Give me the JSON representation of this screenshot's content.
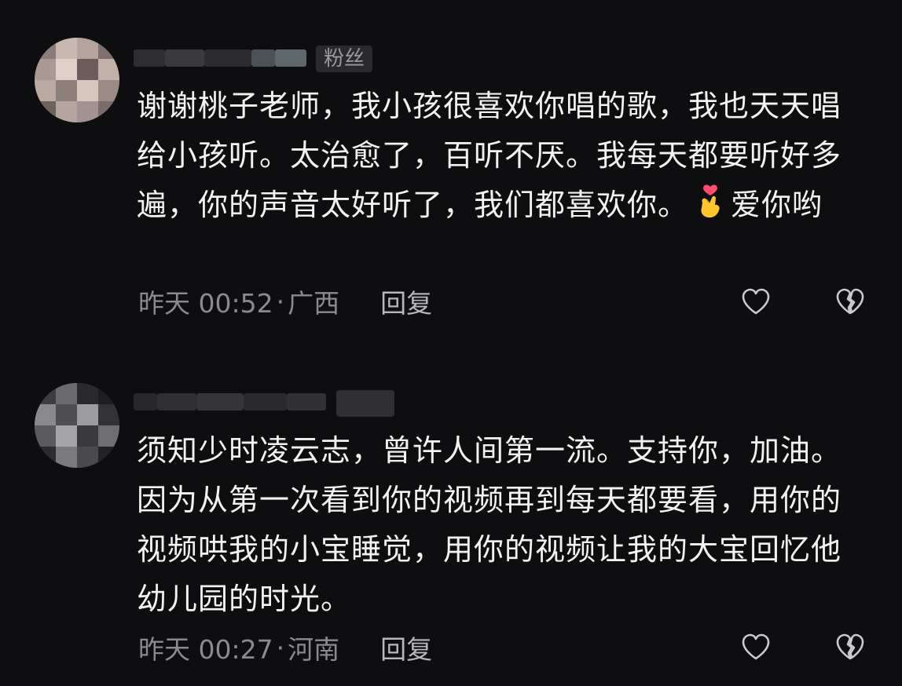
{
  "comments": [
    {
      "badge": "粉丝",
      "text_before_emoji": "谢谢桃子老师，我小孩很喜欢你唱的歌，我也天天唱给小孩听。太治愈了，百听不厌。我每天都要听好多遍，你的声音太好听了，我们都喜欢你。",
      "emoji_name": "finger-heart-emoji",
      "text_after_emoji": "爱你哟",
      "time": "昨天 00:52",
      "separator": "·",
      "location": "广西",
      "reply_label": "回复",
      "like_icon": "heart-outline-icon",
      "dislike_icon": "broken-heart-icon"
    },
    {
      "badge": "",
      "text_before_emoji": "须知少时凌云志，曾许人间第一流。支持你，加油。因为从第一次看到你的视频再到每天都要看，用你的视频哄我的小宝睡觉，用你的视频让我的大宝回忆他幼儿园的时光。",
      "emoji_name": "",
      "text_after_emoji": "",
      "time": "昨天 00:27",
      "separator": "·",
      "location": "河南",
      "reply_label": "回复",
      "like_icon": "heart-outline-icon",
      "dislike_icon": "broken-heart-icon"
    }
  ],
  "colors": {
    "background": "#0e0e10",
    "text": "#f2f2f2",
    "meta": "#8b8b8f",
    "badge_bg": "#2a2a2d"
  }
}
